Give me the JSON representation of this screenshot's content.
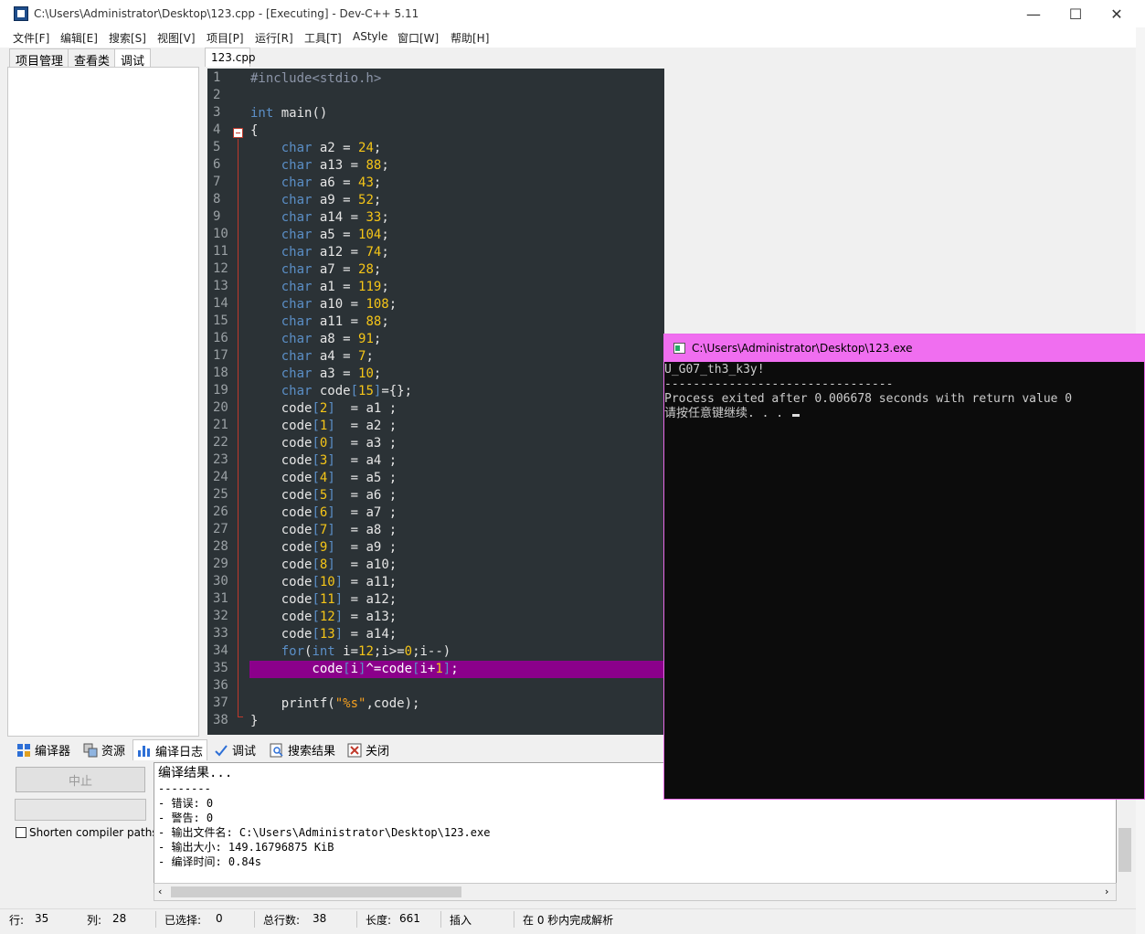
{
  "window": {
    "title": "C:\\Users\\Administrator\\Desktop\\123.cpp - [Executing] - Dev-C++ 5.11",
    "minimize": "—",
    "maximize": "☐",
    "close": "✕"
  },
  "menu": [
    "文件[F]",
    "编辑[E]",
    "搜索[S]",
    "视图[V]",
    "项目[P]",
    "运行[R]",
    "工具[T]",
    "AStyle",
    "窗口[W]",
    "帮助[H]"
  ],
  "left_tabs": [
    "项目管理",
    "查看类",
    "调试"
  ],
  "editor": {
    "file_tab": "123.cpp",
    "lines": [
      "#include<stdio.h>",
      "",
      "int main()",
      "{",
      "    char a2 = 24;",
      "    char a13 = 88;",
      "    char a6 = 43;",
      "    char a9 = 52;",
      "    char a14 = 33;",
      "    char a5 = 104;",
      "    char a12 = 74;",
      "    char a7 = 28;",
      "    char a1 = 119;",
      "    char a10 = 108;",
      "    char a11 = 88;",
      "    char a8 = 91;",
      "    char a4 = 7;",
      "    char a3 = 10;",
      "    char code[15]={};",
      "    code[2]  = a1 ;",
      "    code[1]  = a2 ;",
      "    code[0]  = a3 ;",
      "    code[3]  = a4 ;",
      "    code[4]  = a5 ;",
      "    code[5]  = a6 ;",
      "    code[6]  = a7 ;",
      "    code[7]  = a8 ;",
      "    code[9]  = a9 ;",
      "    code[8]  = a10;",
      "    code[10] = a11;",
      "    code[11] = a12;",
      "    code[12] = a13;",
      "    code[13] = a14;",
      "    for(int i=12;i>=0;i--)",
      "        code[i]^=code[i+1];",
      "",
      "    printf(\"%s\",code);",
      "}"
    ],
    "highlighted_line": 35
  },
  "bottom_tabs": [
    "编译器",
    "资源",
    "编译日志",
    "调试",
    "搜索结果",
    "关闭"
  ],
  "bottom_left": {
    "stop_button": "中止",
    "shorten_label": "Shorten compiler paths"
  },
  "log": {
    "title": "编译结果...",
    "lines": [
      "--------",
      "- 错误: 0",
      "- 警告: 0",
      "- 输出文件名: C:\\Users\\Administrator\\Desktop\\123.exe",
      "- 输出大小: 149.16796875 KiB",
      "- 编译时间: 0.84s"
    ]
  },
  "status": {
    "row_label": "行:",
    "row_value": "35",
    "col_label": "列:",
    "col_value": "28",
    "sel_label": "已选择:",
    "sel_value": "0",
    "lines_label": "总行数:",
    "lines_value": "38",
    "len_label": "长度:",
    "len_value": "661",
    "mode": "插入",
    "parse": "在 0 秒内完成解析"
  },
  "console": {
    "title": "C:\\Users\\Administrator\\Desktop\\123.exe",
    "lines": [
      "U_G07_th3_k3y!",
      "--------------------------------",
      "Process exited after 0.006678 seconds with return value 0",
      "请按任意键继续. . . "
    ]
  },
  "colors": {
    "editor_bg": "#2b3236",
    "highlight": "#8b008b",
    "console_title": "#f06ef0",
    "keyword": "#5b8fc7",
    "number": "#f5c518"
  }
}
